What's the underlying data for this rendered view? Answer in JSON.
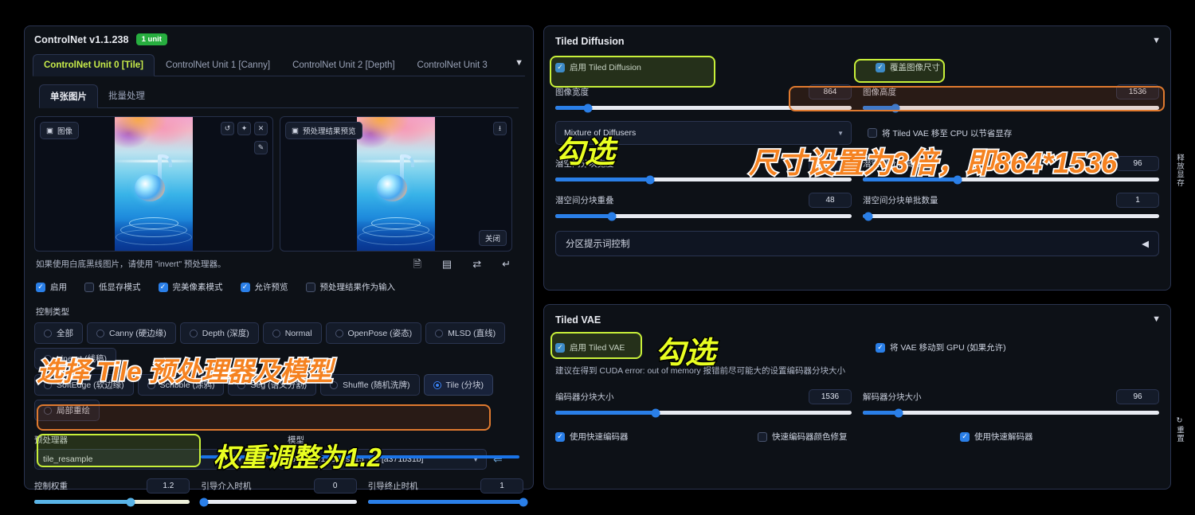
{
  "controlnet": {
    "title": "ControlNet v1.1.238",
    "unit_badge": "1 unit",
    "collapse_icon": "▼",
    "tabs": [
      {
        "label": "ControlNet Unit 0 [Tile]",
        "active": true
      },
      {
        "label": "ControlNet Unit 1 [Canny]",
        "active": false
      },
      {
        "label": "ControlNet Unit 2 [Depth]",
        "active": false
      },
      {
        "label": "ControlNet Unit 3",
        "active": false
      }
    ],
    "subtabs": [
      {
        "label": "单张图片",
        "active": true
      },
      {
        "label": "批量处理",
        "active": false
      }
    ],
    "image_box": {
      "tag": "图像",
      "tag_icon": "image-icon",
      "tools": [
        "undo-icon",
        "erase-icon",
        "close-icon"
      ],
      "tool2": [
        "edit-icon"
      ]
    },
    "preview_box": {
      "tag": "预处理结果预览",
      "tag_icon": "image-icon",
      "download_icon": "download-icon",
      "close_label": "关闭"
    },
    "hint": "如果使用白底黑线图片，请使用 \"invert\" 预处理器。",
    "mini_icons": [
      "file-icon",
      "camera-icon",
      "swap-icon",
      "return-icon"
    ],
    "checkboxes": [
      {
        "label": "启用",
        "checked": true
      },
      {
        "label": "低显存模式",
        "checked": false
      },
      {
        "label": "完美像素模式",
        "checked": true
      },
      {
        "label": "允许预览",
        "checked": true
      },
      {
        "label": "预处理结果作为输入",
        "checked": false
      }
    ],
    "control_type_label": "控制类型",
    "control_types_row1": [
      {
        "label": "全部",
        "selected": false
      },
      {
        "label": "Canny (硬边缘)",
        "selected": false
      },
      {
        "label": "Depth (深度)",
        "selected": false
      },
      {
        "label": "Normal",
        "selected": false
      },
      {
        "label": "OpenPose (姿态)",
        "selected": false
      },
      {
        "label": "MLSD (直线)",
        "selected": false
      },
      {
        "label": "Lineart (线稿)",
        "selected": false
      }
    ],
    "control_types_row2": [
      {
        "label": "SoftEdge (软边缘)",
        "selected": false
      },
      {
        "label": "Scribble (涂鸦)",
        "selected": false
      },
      {
        "label": "Seg (语义分割)",
        "selected": false
      },
      {
        "label": "Shuffle (随机洗牌)",
        "selected": false
      },
      {
        "label": "Tile (分块)",
        "selected": true
      },
      {
        "label": "局部重绘",
        "selected": false
      }
    ],
    "preprocessor_label": "预处理器",
    "preprocessor_value": "tile_resample",
    "model_label": "模型",
    "model_value": "control_v11f1e_sd15_tile [a371b31b]",
    "run_icon": "spark-icon",
    "swap_icon": "swap-models-icon",
    "weight": {
      "label": "控制权重",
      "value": "1.2",
      "pct": 62
    },
    "guidance_start": {
      "label": "引导介入时机",
      "value": "0",
      "pct": 2
    },
    "guidance_end": {
      "label": "引导终止时机",
      "value": "1",
      "pct": 100
    }
  },
  "tiled_diffusion": {
    "title": "Tiled Diffusion",
    "collapse_icon": "▼",
    "enable": {
      "label": "启用 Tiled Diffusion",
      "checked": true
    },
    "override_size": {
      "label": "覆盖图像尺寸",
      "checked": true
    },
    "image_width": {
      "label": "图像宽度",
      "value": "864",
      "pct": 11
    },
    "image_height": {
      "label": "图像高度",
      "value": "1536",
      "pct": 11
    },
    "method_value": "Mixture of Diffusers",
    "move_to_cpu": {
      "label": "将 Tiled VAE 移至 CPU 以节省显存",
      "checked": false
    },
    "latent_tile_width": {
      "label": "潜空间分块宽度",
      "value": "96",
      "pct": 32
    },
    "latent_tile_height": {
      "label": "潜空间分块高度",
      "value": "96",
      "pct": 32
    },
    "latent_tile_overlap": {
      "label": "潜空间分块重叠",
      "value": "48",
      "pct": 19
    },
    "latent_tile_batch": {
      "label": "潜空间分块单批数量",
      "value": "1",
      "pct": 2
    },
    "region_prompt": {
      "label": "分区提示词控制",
      "caret": "◀"
    },
    "free_vram_button": "释放显存"
  },
  "tiled_vae": {
    "title": "Tiled VAE",
    "collapse_icon": "▼",
    "enable": {
      "label": "启用 Tiled VAE",
      "checked": true
    },
    "move_vae_gpu": {
      "label": "将 VAE 移动到 GPU (如果允许)",
      "checked": true
    },
    "hint": "建议在得到 CUDA error: out of memory 报错前尽可能大的设置编码器分块大小",
    "encoder_tile": {
      "label": "编码器分块大小",
      "value": "1536",
      "pct": 34
    },
    "decoder_tile": {
      "label": "解码器分块大小",
      "value": "96",
      "pct": 12
    },
    "checkboxes": [
      {
        "label": "使用快速编码器",
        "checked": true
      },
      {
        "label": "快速编码器颜色修复",
        "checked": false
      },
      {
        "label": "使用快速解码器",
        "checked": true
      }
    ],
    "reset_button": "重置",
    "reset_icon": "↻"
  },
  "annotations": [
    {
      "id": "a-gouxuan-1",
      "text": "勾选",
      "style": "yellow"
    },
    {
      "id": "a-size",
      "text": "尺寸设置为3倍，即864*1536",
      "style": "orange"
    },
    {
      "id": "a-gouxuan-2",
      "text": "勾选",
      "style": "yellow"
    },
    {
      "id": "a-tile",
      "text": "选择 Tile 预处理器及模型",
      "style": "orange"
    },
    {
      "id": "a-weight",
      "text": "权重调整为1.2",
      "style": "yellow"
    }
  ]
}
